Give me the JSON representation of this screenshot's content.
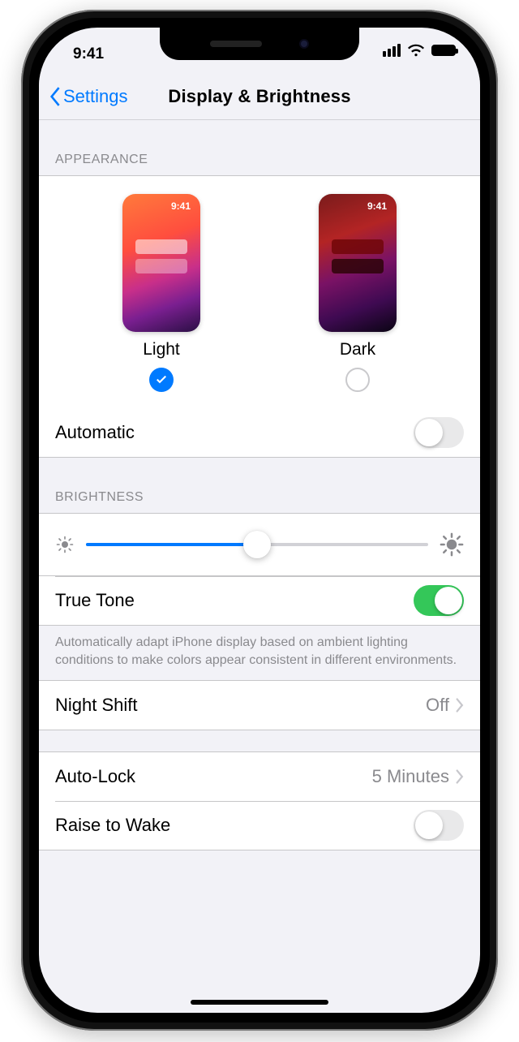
{
  "status": {
    "time": "9:41"
  },
  "nav": {
    "back": "Settings",
    "title": "Display & Brightness"
  },
  "appearance": {
    "header": "APPEARANCE",
    "light_label": "Light",
    "dark_label": "Dark",
    "thumb_time": "9:41",
    "selected": "light",
    "automatic_label": "Automatic",
    "automatic_on": false
  },
  "brightness": {
    "header": "BRIGHTNESS",
    "value_percent": 50,
    "truetone_label": "True Tone",
    "truetone_on": true,
    "footer": "Automatically adapt iPhone display based on ambient lighting conditions to make colors appear consistent in different environments."
  },
  "nightshift": {
    "label": "Night Shift",
    "value": "Off"
  },
  "autolock": {
    "label": "Auto-Lock",
    "value": "5 Minutes"
  },
  "raise": {
    "label": "Raise to Wake",
    "on": false
  }
}
